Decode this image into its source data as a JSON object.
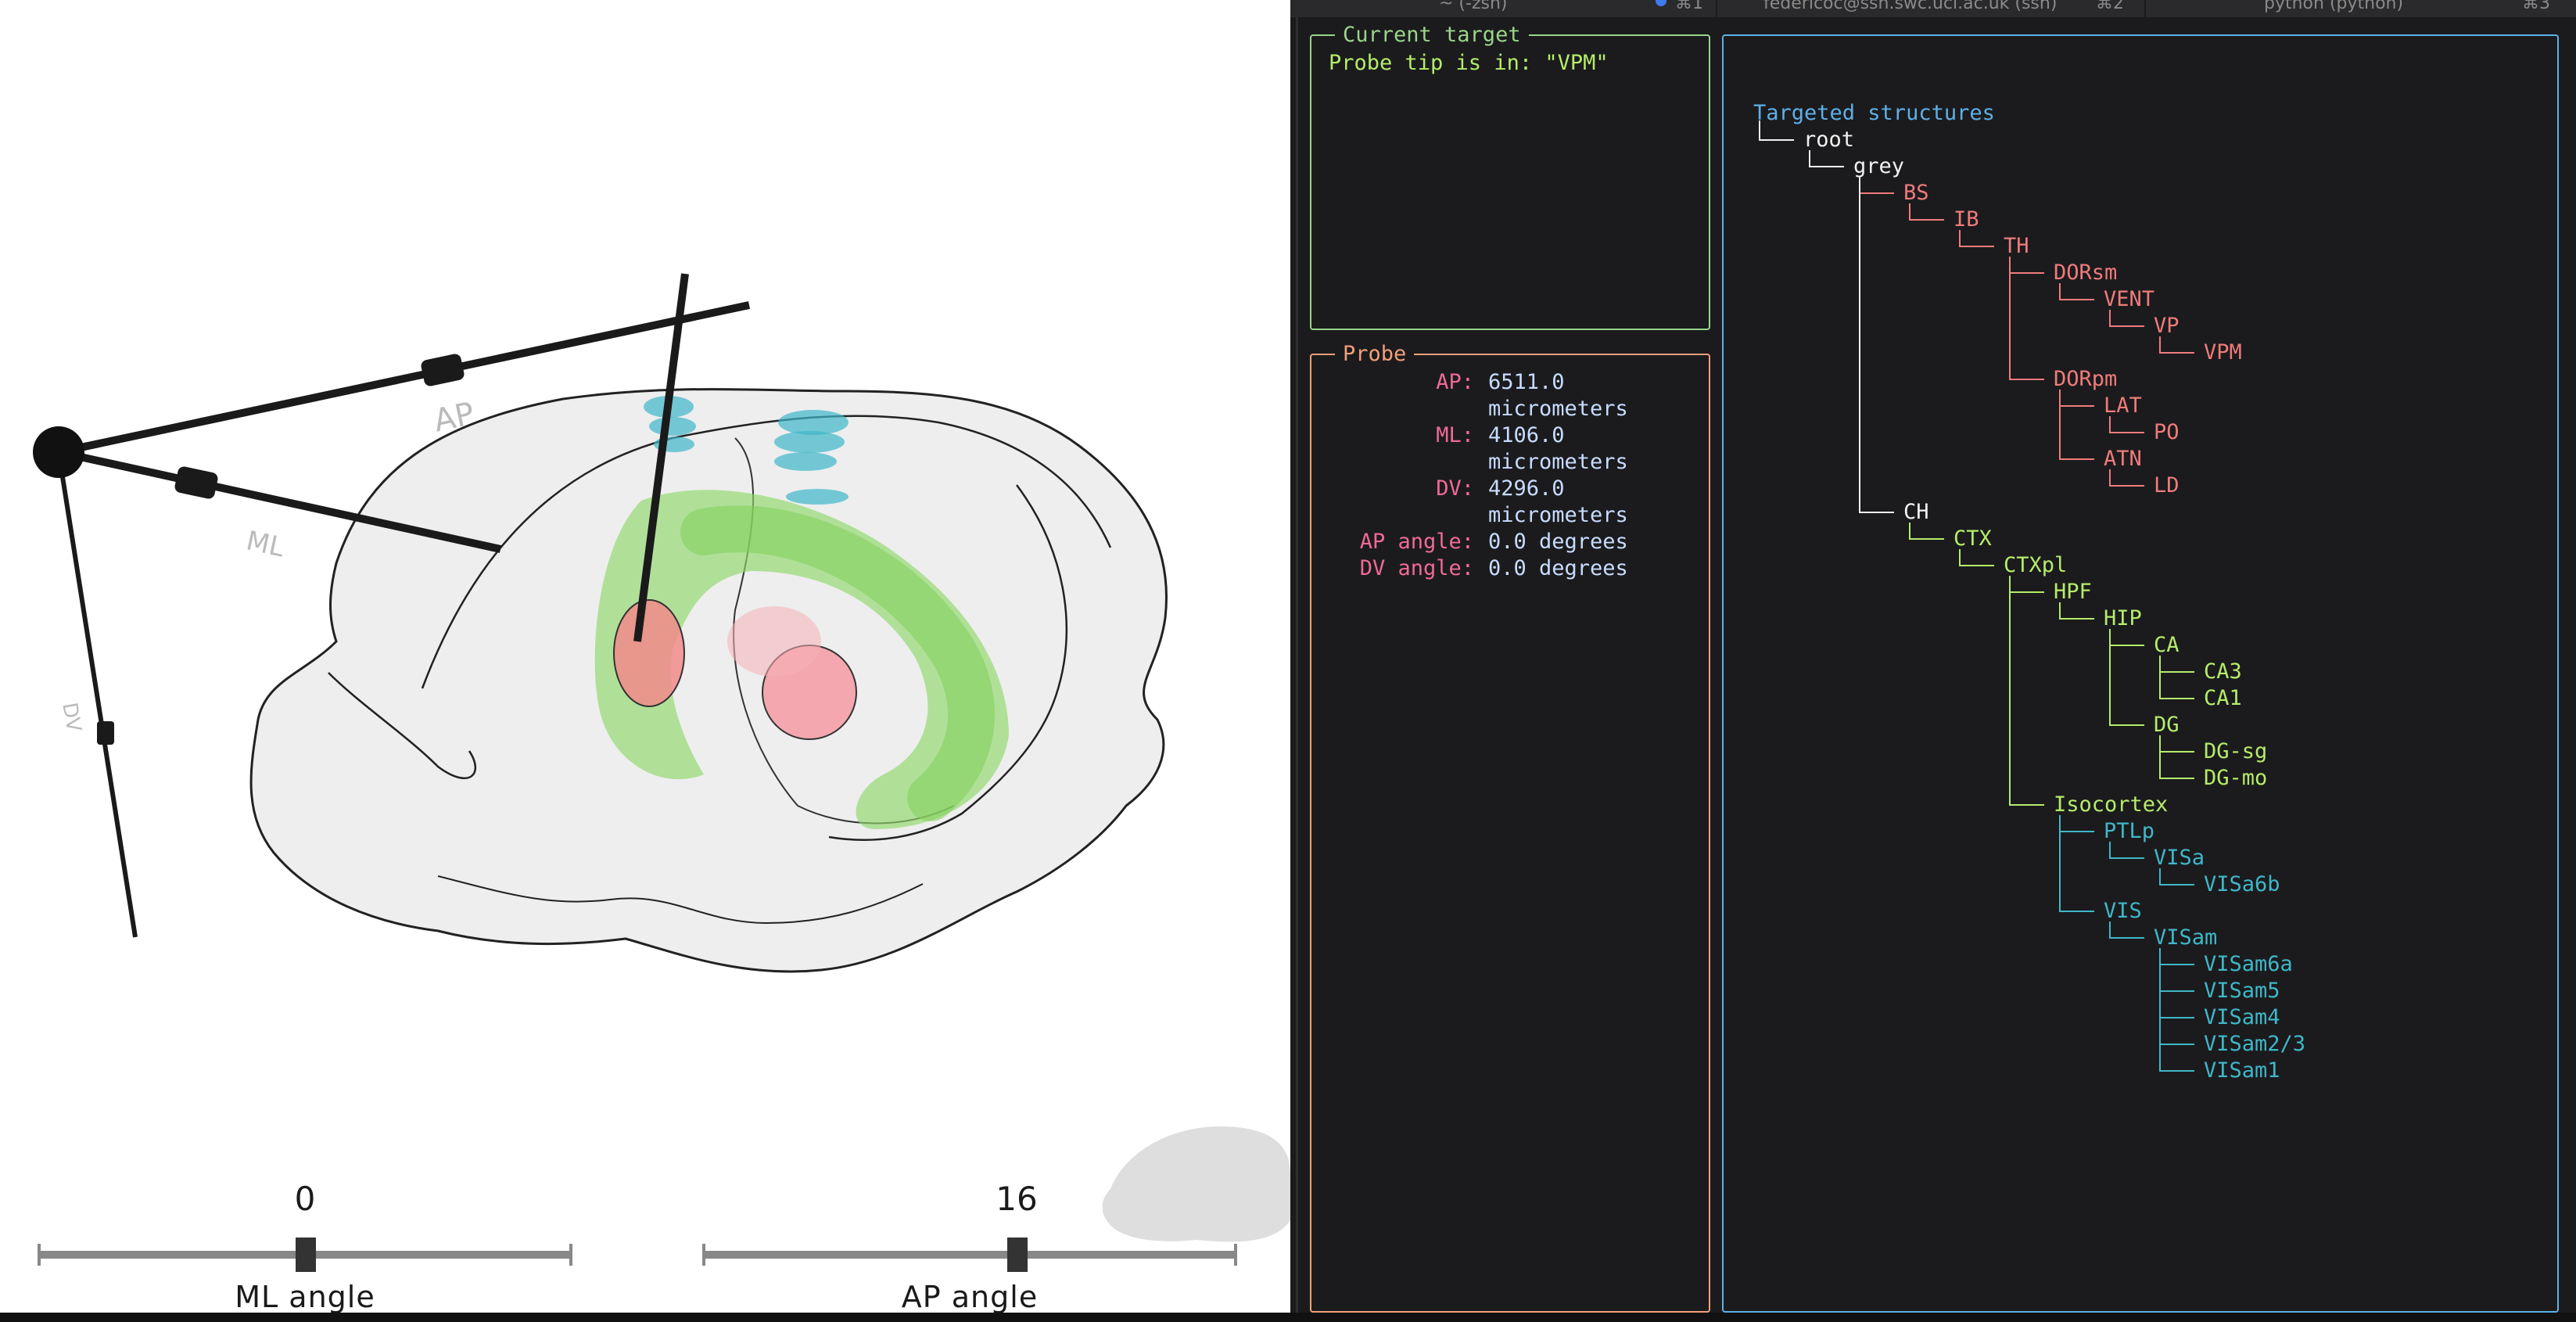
{
  "terminal": {
    "tabs": [
      {
        "label": "~ (-zsh)",
        "shortcut": "⌘1"
      },
      {
        "label": "federicoc@ssh.swc.ucl.ac.uk (ssh)",
        "shortcut": "⌘2"
      },
      {
        "label": "python (python)",
        "shortcut": "⌘3"
      }
    ],
    "current_target": {
      "title": "Current target",
      "text": "Probe tip is in: \"VPM\""
    },
    "probe": {
      "title": "Probe",
      "rows": [
        {
          "key": "AP:",
          "value": "6511.0"
        },
        {
          "key": "",
          "value": "micrometers"
        },
        {
          "key": "ML:",
          "value": "4106.0"
        },
        {
          "key": "",
          "value": "micrometers"
        },
        {
          "key": "DV:",
          "value": "4296.0"
        },
        {
          "key": "",
          "value": "micrometers"
        },
        {
          "key": "AP angle:",
          "value": "0.0 degrees"
        },
        {
          "key": "DV angle:",
          "value": "0.0 degrees"
        }
      ]
    },
    "tree": {
      "title": "Targeted structures",
      "nodes": [
        {
          "label": "root",
          "depth": 0,
          "color": "white"
        },
        {
          "label": "grey",
          "depth": 1,
          "color": "white"
        },
        {
          "label": "BS",
          "depth": 2,
          "color": "red"
        },
        {
          "label": "IB",
          "depth": 3,
          "color": "red"
        },
        {
          "label": "TH",
          "depth": 4,
          "color": "red"
        },
        {
          "label": "DORsm",
          "depth": 5,
          "color": "red"
        },
        {
          "label": "VENT",
          "depth": 6,
          "color": "red"
        },
        {
          "label": "VP",
          "depth": 7,
          "color": "red"
        },
        {
          "label": "VPM",
          "depth": 8,
          "color": "red"
        },
        {
          "label": "DORpm",
          "depth": 5,
          "color": "red"
        },
        {
          "label": "LAT",
          "depth": 6,
          "color": "red"
        },
        {
          "label": "PO",
          "depth": 7,
          "color": "red"
        },
        {
          "label": "ATN",
          "depth": 6,
          "color": "red"
        },
        {
          "label": "LD",
          "depth": 7,
          "color": "red"
        },
        {
          "label": "CH",
          "depth": 2,
          "color": "white"
        },
        {
          "label": "CTX",
          "depth": 3,
          "color": "green"
        },
        {
          "label": "CTXpl",
          "depth": 4,
          "color": "green"
        },
        {
          "label": "HPF",
          "depth": 5,
          "color": "green"
        },
        {
          "label": "HIP",
          "depth": 6,
          "color": "green"
        },
        {
          "label": "CA",
          "depth": 7,
          "color": "green"
        },
        {
          "label": "CA3",
          "depth": 8,
          "color": "green"
        },
        {
          "label": "CA1",
          "depth": 8,
          "color": "green"
        },
        {
          "label": "DG",
          "depth": 7,
          "color": "green"
        },
        {
          "label": "DG-sg",
          "depth": 8,
          "color": "green"
        },
        {
          "label": "DG-mo",
          "depth": 8,
          "color": "green"
        },
        {
          "label": "Isocortex",
          "depth": 5,
          "color": "green"
        },
        {
          "label": "PTLp",
          "depth": 6,
          "color": "teal"
        },
        {
          "label": "VISa",
          "depth": 7,
          "color": "teal"
        },
        {
          "label": "VISa6b",
          "depth": 8,
          "color": "teal"
        },
        {
          "label": "VIS",
          "depth": 6,
          "color": "teal"
        },
        {
          "label": "VISam",
          "depth": 7,
          "color": "teal"
        },
        {
          "label": "VISam6a",
          "depth": 8,
          "color": "teal"
        },
        {
          "label": "VISam5",
          "depth": 8,
          "color": "teal"
        },
        {
          "label": "VISam4",
          "depth": 8,
          "color": "teal"
        },
        {
          "label": "VISam2/3",
          "depth": 8,
          "color": "teal"
        },
        {
          "label": "VISam1",
          "depth": 8,
          "color": "teal"
        }
      ]
    }
  },
  "viewer": {
    "axis_labels": {
      "ap": "AP",
      "ml": "ML",
      "dv": "DV"
    },
    "sliders": [
      {
        "label": "ML angle",
        "value": "0",
        "fraction": 0.5
      },
      {
        "label": "AP angle",
        "value": "16",
        "fraction": 0.59
      }
    ]
  },
  "colors": {
    "red": "#f07b7b",
    "green": "#b6ec6a",
    "teal": "#3fb7c9",
    "blue": "#5db0e8",
    "white": "#f2f2f2",
    "panel_green": "#9ad48a",
    "panel_red": "#f2a07a",
    "panel_blue": "#5db0e8",
    "probe_key": "#f06a95"
  }
}
